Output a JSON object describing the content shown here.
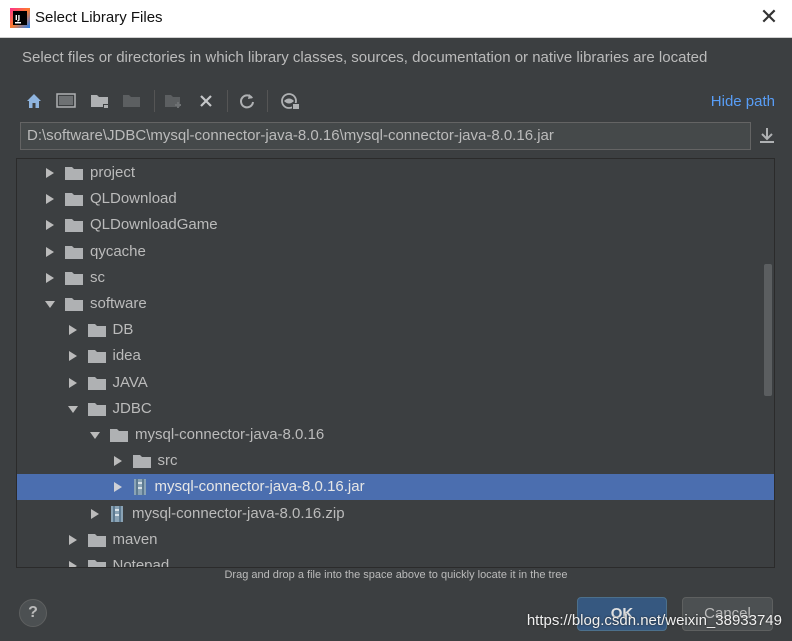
{
  "window": {
    "title": "Select Library Files",
    "close_glyph": "✕"
  },
  "description": "Select files or directories in which library classes, sources, documentation or native libraries are located",
  "toolbar": {
    "buttons": [
      "home-icon",
      "desktop-icon",
      "new-folder-icon",
      "new-folder-disabled-icon",
      "new-file-icon",
      "delete-icon",
      "refresh-icon",
      "show-hidden-icon"
    ],
    "hide_path_label": "Hide path"
  },
  "path": {
    "value": "D:\\software\\JDBC\\mysql-connector-java-8.0.16\\mysql-connector-java-8.0.16.jar"
  },
  "tree": {
    "items": [
      {
        "label": "project",
        "level": 0,
        "expanded": false,
        "kind": "folder"
      },
      {
        "label": "QLDownload",
        "level": 0,
        "expanded": false,
        "kind": "folder"
      },
      {
        "label": "QLDownloadGame",
        "level": 0,
        "expanded": false,
        "kind": "folder"
      },
      {
        "label": "qycache",
        "level": 0,
        "expanded": false,
        "kind": "folder"
      },
      {
        "label": "sc",
        "level": 0,
        "expanded": false,
        "kind": "folder"
      },
      {
        "label": "software",
        "level": 0,
        "expanded": true,
        "kind": "folder"
      },
      {
        "label": "DB",
        "level": 1,
        "expanded": false,
        "kind": "folder"
      },
      {
        "label": "idea",
        "level": 1,
        "expanded": false,
        "kind": "folder"
      },
      {
        "label": "JAVA",
        "level": 1,
        "expanded": false,
        "kind": "folder"
      },
      {
        "label": "JDBC",
        "level": 1,
        "expanded": true,
        "kind": "folder"
      },
      {
        "label": "mysql-connector-java-8.0.16",
        "level": 2,
        "expanded": true,
        "kind": "folder"
      },
      {
        "label": "src",
        "level": 3,
        "expanded": false,
        "kind": "folder"
      },
      {
        "label": "mysql-connector-java-8.0.16.jar",
        "level": 3,
        "expanded": false,
        "kind": "jar",
        "selected": true
      },
      {
        "label": "mysql-connector-java-8.0.16.zip",
        "level": 2,
        "expanded": false,
        "kind": "jar"
      },
      {
        "label": "maven",
        "level": 1,
        "expanded": false,
        "kind": "folder"
      },
      {
        "label": "Notepad",
        "level": 1,
        "expanded": false,
        "kind": "folder"
      }
    ]
  },
  "hint": "Drag and drop a file into the space above to quickly locate it in the tree",
  "footer": {
    "help_label": "?",
    "ok_label": "OK",
    "cancel_label": "Cancel"
  },
  "watermark": "https://blog.csdn.net/weixin_38933749",
  "colors": {
    "background": "#3c3f41",
    "selection": "#4b6eaf",
    "link": "#589df6",
    "ok_button": "#365880"
  }
}
